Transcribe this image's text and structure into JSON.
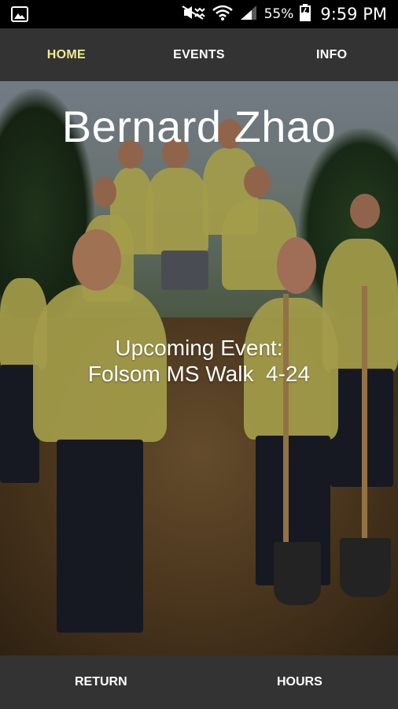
{
  "status_bar": {
    "battery": "55%",
    "time": "9:59 PM",
    "icons": [
      "gallery-icon",
      "mute-icon",
      "wifi-icon",
      "signal-icon",
      "battery-icon"
    ]
  },
  "nav": {
    "tabs": [
      {
        "label": "HOME",
        "active": true
      },
      {
        "label": "EVENTS",
        "active": false
      },
      {
        "label": "INFO",
        "active": false
      }
    ],
    "active_color": "#f2ec8f",
    "bar_color": "#333333"
  },
  "hero": {
    "title": "Bernard Zhao",
    "event_heading": "Upcoming Event:",
    "event_name": "Folsom MS Walk  4-24"
  },
  "bottom_bar": {
    "return_label": "RETURN",
    "hours_label": "HOURS"
  }
}
